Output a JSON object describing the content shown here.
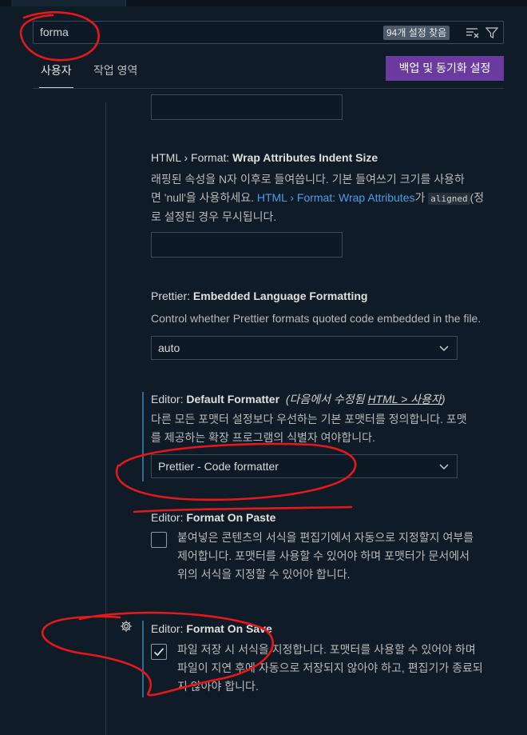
{
  "search": {
    "value": "forma",
    "result_count": "94개 설정 찾음"
  },
  "icons": {
    "clear_filter": "clear-filter-icon",
    "filter": "filter-icon",
    "chevron": "chevron-down-icon",
    "gear": "gear-icon",
    "check": "check-icon"
  },
  "tabs": {
    "user": "사용자",
    "workspace": "작업 영역",
    "sync_button": "백업 및 동기화 설정"
  },
  "settings": {
    "wrap_indent": {
      "category": "HTML › Format: ",
      "name": "Wrap Attributes Indent Size",
      "desc_line1": "래핑된 속성을 N자 이후로 들여씁니다. 기본 들여쓰기 크기를 사용하",
      "desc_line2_a": "면 'null'을 사용하세요. ",
      "desc_line2_link": "HTML › Format: Wrap Attributes",
      "desc_line2_b": "가 ",
      "desc_line2_code": "aligned",
      "desc_line2_c": "(정",
      "desc_line3": "로 설정된 경우 무시됩니다."
    },
    "prettier_embedded": {
      "category": "Prettier: ",
      "name": "Embedded Language Formatting",
      "desc": "Control whether Prettier formats quoted code embedded in the file.",
      "value": "auto"
    },
    "default_formatter": {
      "category": "Editor: ",
      "name": "Default Formatter",
      "modified_prefix": "(다음에서 수정됨 ",
      "modified_link": "HTML > 사용자",
      "modified_suffix": ")",
      "desc_line1": "다른 모든 포맷터 설정보다 우선하는 기본 포맷터를 정의합니다. 포맷",
      "desc_line2": "를 제공하는 확장 프로그램의 식별자 여야합니다.",
      "value": "Prettier - Code formatter"
    },
    "format_on_paste": {
      "category": "Editor: ",
      "name": "Format On Paste",
      "desc_line1": "붙여넣은 콘텐츠의 서식을 편집기에서 자동으로 지정할지 여부를",
      "desc_line2": "제어합니다. 포맷터를 사용할 수 있어야 하며 포맷터가 문서에서",
      "desc_line3": "위의 서식을 지정할 수 있어야 합니다.",
      "checked": false
    },
    "format_on_save": {
      "category": "Editor: ",
      "name": "Format On Save",
      "desc_line1": "파일 저장 시 서식을 지정합니다. 포맷터를 사용할 수 있어야 하며",
      "desc_line2": "파일이 지연 후에 자동으로 저장되지 않아야 하고, 편집기가 종료되",
      "desc_line3": "지 않아야 합니다.",
      "checked": true
    }
  },
  "annotation_color": "#e3191c"
}
